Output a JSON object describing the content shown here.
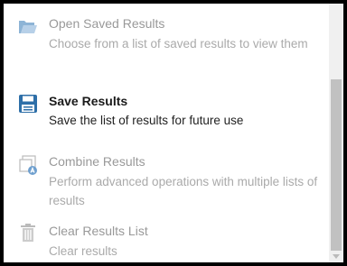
{
  "menu": {
    "items": [
      {
        "icon": "folder-open-icon",
        "title": "Open Saved Results",
        "desc": "Choose from a list of saved results to view them",
        "enabled": false
      },
      {
        "icon": "save-floppy-icon",
        "title": "Save Results",
        "desc": "Save the list of results for future use",
        "enabled": true
      },
      {
        "icon": "combine-lists-icon",
        "title": "Combine Results",
        "desc": "Perform advanced operations with multiple lists of results",
        "enabled": false
      },
      {
        "icon": "trash-icon",
        "title": "Clear Results List",
        "desc": "Clear results",
        "enabled": false
      }
    ]
  },
  "colors": {
    "accent": "#2e6fa8",
    "disabled_text": "#aaaaaa",
    "active_text": "#1a1a1a"
  }
}
